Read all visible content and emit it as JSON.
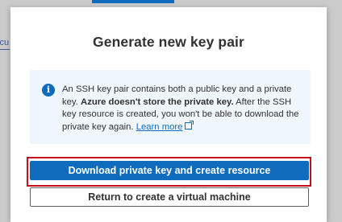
{
  "background": {
    "edge_text": "lcu"
  },
  "dialog": {
    "title": "Generate new key pair",
    "info": {
      "icon": "info-icon",
      "text_part1": "An SSH key pair contains both a public key and a private key. ",
      "text_bold": "Azure doesn't store the private key.",
      "text_part2": " After the SSH key resource is created, you won't be able to download the private key again. ",
      "learn_more_label": "Learn more",
      "learn_more_icon": "external-link-icon"
    },
    "primary_button_label": "Download private key and create resource",
    "secondary_button_label": "Return to create a virtual machine"
  },
  "colors": {
    "accent": "#0f6cbd",
    "highlight_border": "#c50f1f",
    "info_background": "#eff6fc"
  }
}
